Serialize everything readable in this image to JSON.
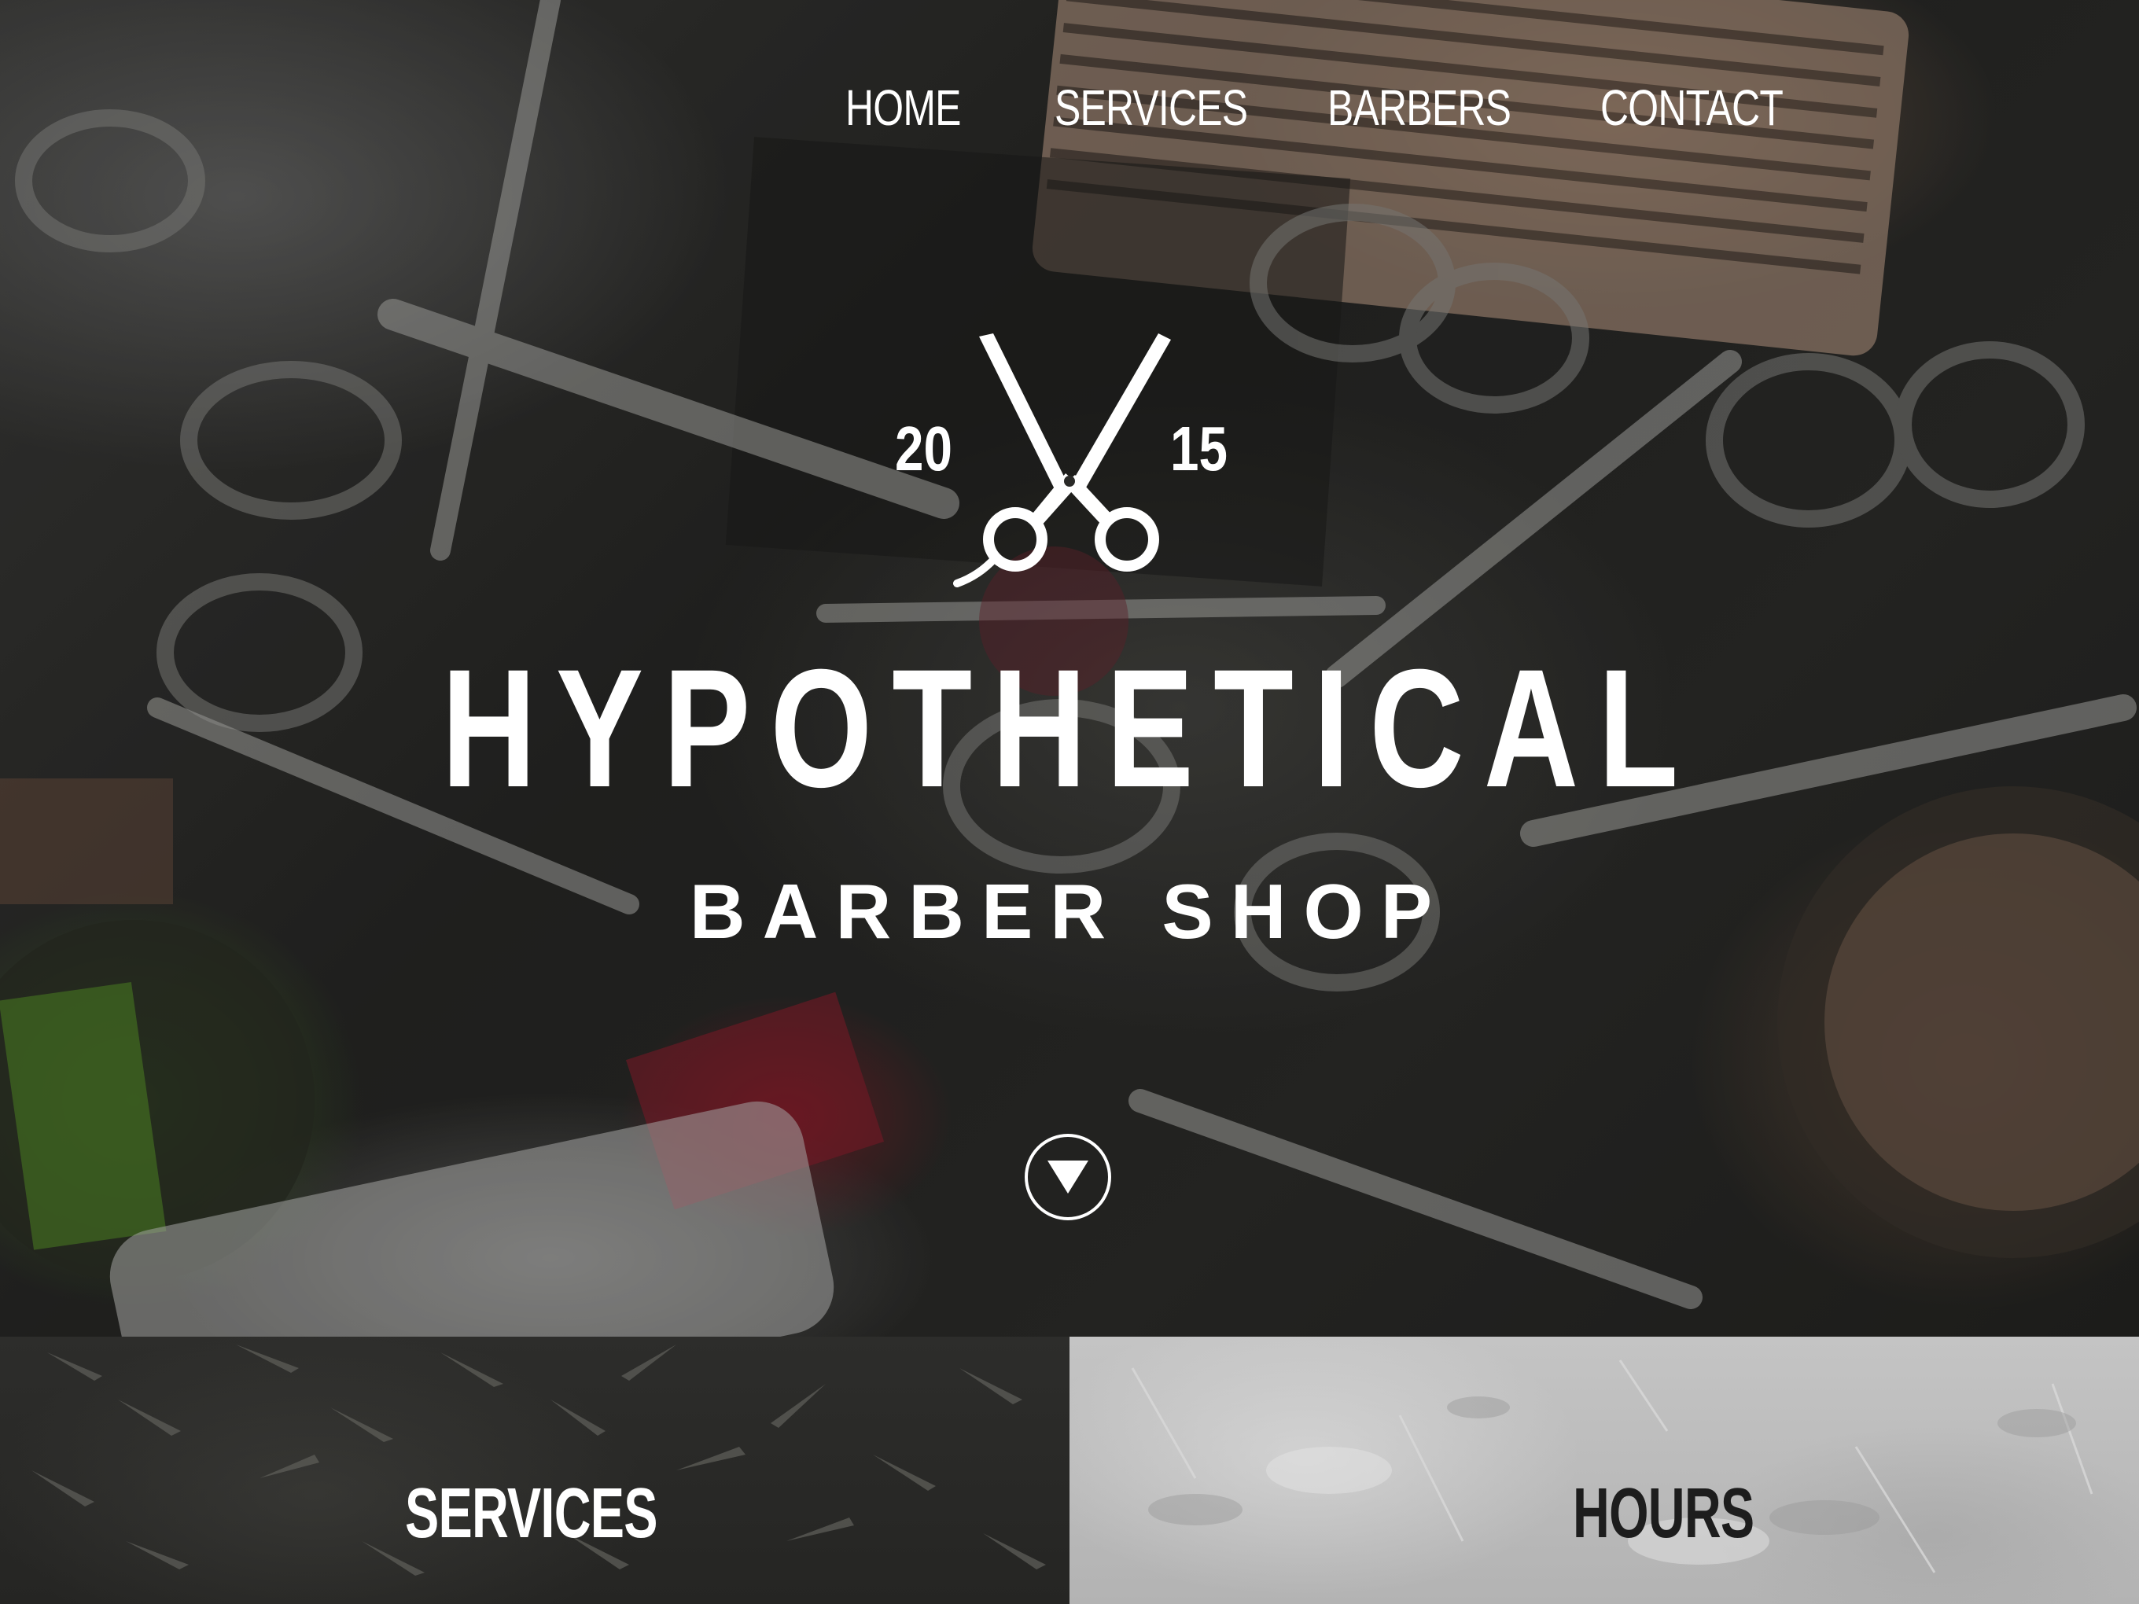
{
  "nav": {
    "items": [
      {
        "label": "HOME"
      },
      {
        "label": "SERVICES"
      },
      {
        "label": "BARBERS"
      },
      {
        "label": "CONTACT"
      }
    ]
  },
  "hero": {
    "year_left": "20",
    "year_right": "15",
    "title": "HYPOTHETICAL",
    "subtitle": "BARBER SHOP",
    "logo_icon": "scissors-icon",
    "scroll_icon": "triangle-down-icon"
  },
  "panels": {
    "services_heading": "SERVICES",
    "hours_heading": "HOURS"
  },
  "colors": {
    "text_light": "#ffffff",
    "text_dark": "#1d1d1d",
    "services_bg": "#2a2a28",
    "hours_bg": "#bcbcbc"
  }
}
